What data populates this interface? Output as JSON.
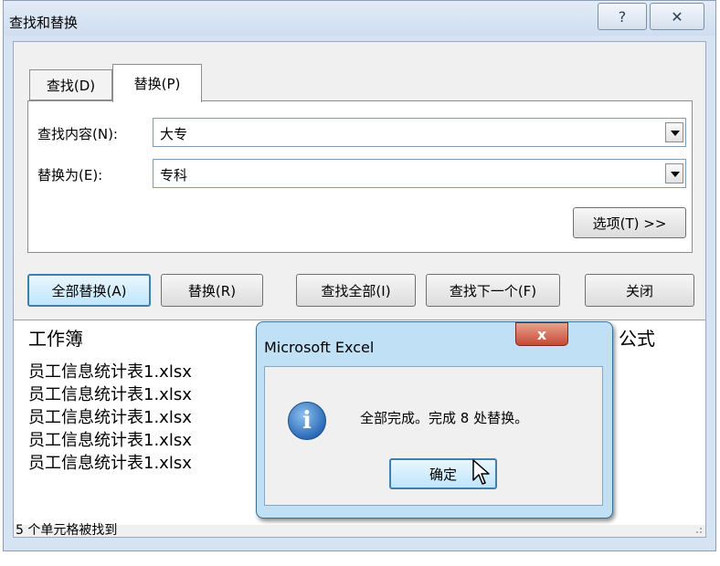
{
  "dialog": {
    "title": "查找和替换",
    "help_glyph": "?",
    "close_glyph": "✕"
  },
  "tabs": {
    "find_label": "查找(D)",
    "replace_label": "替换(P)"
  },
  "form": {
    "find_label": "查找内容(N):",
    "find_value": "大专",
    "replace_label": "替换为(E):",
    "replace_value": "专科",
    "options_label": "选项(T) >>"
  },
  "buttons": {
    "replace_all": "全部替换(A)",
    "replace": "替换(R)",
    "find_all": "查找全部(I)",
    "find_next": "查找下一个(F)",
    "close": "关闭"
  },
  "results": {
    "columns": [
      "工作簿",
      "公式"
    ],
    "rows": [
      "员工信息统计表1.xlsx",
      "员工信息统计表1.xlsx",
      "员工信息统计表1.xlsx",
      "员工信息统计表1.xlsx",
      "员工信息统计表1.xlsx"
    ]
  },
  "status": "5 个单元格被找到",
  "message_box": {
    "title": "Microsoft Excel",
    "close_glyph": "x",
    "icon": "info-icon",
    "text": "全部完成。完成 8 处替换。",
    "ok_label": "确定"
  },
  "colors": {
    "frame": "#d6e3f2",
    "default_button": "#bee6fd",
    "msg_frame": "#bfe0f5",
    "msg_close": "#c54a33"
  }
}
